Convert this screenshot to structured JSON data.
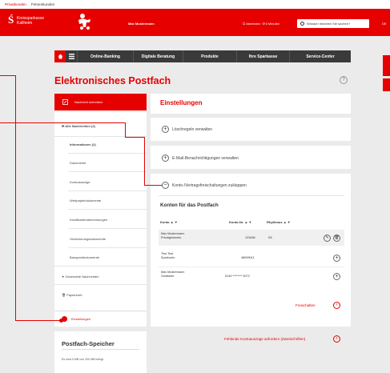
{
  "topnav": {
    "privatkunden": "Privatkunden",
    "firmenkunden": "Firmenkunden"
  },
  "header": {
    "bank_name_1": "Kreissparkasse",
    "bank_name_2": "Kallheim",
    "user": "Max Mustermann",
    "logout": "Abmelden",
    "session": "5 Minuten",
    "search_placeholder": "Wonach möchten Sie suchen?",
    "lang": "DE"
  },
  "nav": {
    "online_banking": "Online-Banking",
    "digitale_beratung": "Digitale Beratung",
    "produkte": "Produkte",
    "ihre_sparkasse": "Ihre Sparkasse",
    "service_center": "Service-Center"
  },
  "page_title": "Elektronisches Postfach",
  "help": "?",
  "sidebar": {
    "new_message": "Nachricht schreiben",
    "all_messages": "Alle Nachrichten (2)",
    "items": [
      "Informationen (2)",
      "Dokumente",
      "Kontoauszüge",
      "Wertpapierdokumente",
      "Kreditkartenabrechnungen",
      "Versicherungsdokumente",
      "Bausparddokumente"
    ],
    "sent": "Gesendete Nachrichten",
    "trash": "Papierkorb",
    "settings": "Einstellungen"
  },
  "storage": {
    "title": "Postfach-Speicher",
    "text": "Es sind 0 MB von 200 MB belegt"
  },
  "settings": {
    "title": "Einstellungen",
    "sections": [
      {
        "label": "Löschregeln verwalten",
        "toggle": "+"
      },
      {
        "label": "E-Mail-Benachrichtigungen verwalten",
        "toggle": "+"
      },
      {
        "label": "Konto-/Vertragsfreischaltungen zuklappen",
        "toggle": "−"
      }
    ]
  },
  "accounts": {
    "title": "Konten für das Postfach",
    "columns": {
      "konto": "Konto",
      "konto_nr": "Konto-Nr.",
      "rhythmus": "Rhythmus"
    },
    "rows": [
      {
        "name": "Max Mustermann",
        "type": "Privatgirokonto",
        "number": "123456",
        "rhythmus": "K8"
      },
      {
        "name": "Tina Test",
        "type": "Sparkonto",
        "number": "48999011",
        "rhythmus": ""
      },
      {
        "name": "Max Mustermann",
        "type": "Goldkarte",
        "number": "5149 ******** 9072",
        "rhythmus": ""
      }
    ],
    "release": "Freischalten",
    "missing_link": "Fehlende Kontoauszüge anfordern (Zweitschriften)"
  },
  "colors": {
    "brand": "#e60000",
    "nav": "#3a3a3a",
    "background": "#ebebeb"
  }
}
